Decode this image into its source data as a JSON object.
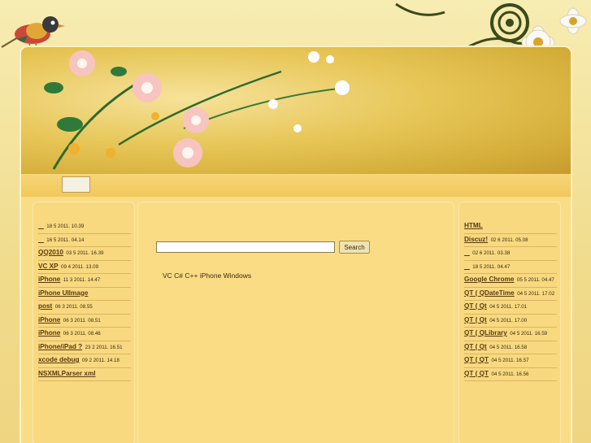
{
  "search": {
    "button_label": "Search",
    "placeholder": ""
  },
  "tags_line": "VC C# C++ iPhone Windows",
  "left_list": [
    {
      "title": "",
      "date": "18 5  2011. 10.39"
    },
    {
      "title": "",
      "date": "16 5  2011. 04.14"
    },
    {
      "title": "QQ2010",
      "date": "03 5  2011. 16.39"
    },
    {
      "title": "VC    XP",
      "date": "09 4  2011. 13.09"
    },
    {
      "title": "iPhone",
      "date": "11 3  2011. 14.47"
    },
    {
      "title": "iPhone  UIImage",
      "date": ""
    },
    {
      "title": "post",
      "date": "06 3  2011. 08.55"
    },
    {
      "title": "iPhone",
      "date": "06 3  2011. 08.51"
    },
    {
      "title": "iPhone",
      "date": "06 3  2011. 08.46"
    },
    {
      "title": "iPhone/iPad       ?",
      "date": "23 2  2011. 16.51"
    },
    {
      "title": "xcode      debug",
      "date": "09 2  2011. 14.18"
    },
    {
      "title": "NSXMLParser   xml",
      "date": ""
    }
  ],
  "right_list": [
    {
      "title": "HTML",
      "date": ""
    },
    {
      "title": "Discuz!",
      "date": "02 6  2011. 05.08"
    },
    {
      "title": "",
      "date": "02 6  2011. 03.38"
    },
    {
      "title": "",
      "date": "18 5  2011. 04.47"
    },
    {
      "title": "Google Chrome",
      "date": "05 5  2011. 04.47"
    },
    {
      "title": "QT       (      QDateTime",
      "date": "04 5  2011. 17.02"
    },
    {
      "title": "QT       (      Qt",
      "date": "04 5  2011. 17.01"
    },
    {
      "title": "QT       (      Qt",
      "date": "04 5  2011. 17.00"
    },
    {
      "title": "QT       (      QLibrary",
      "date": "04 5  2011. 16.59"
    },
    {
      "title": "QT       (         Qt",
      "date": "04 5  2011. 16.58"
    },
    {
      "title": "QT       (             QT",
      "date": "04 5  2011. 16.57"
    },
    {
      "title": "QT       (             QT",
      "date": "04 5  2011. 16.56"
    }
  ]
}
